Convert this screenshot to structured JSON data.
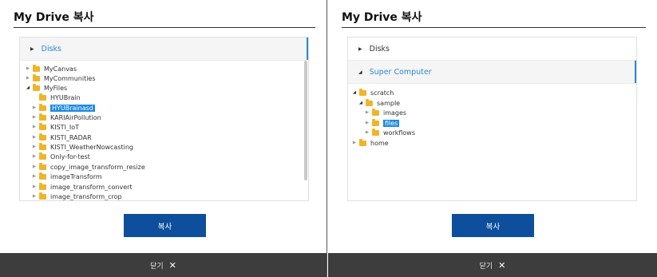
{
  "left": {
    "title": "My Drive 복사",
    "disks_label": "Disks",
    "items": [
      {
        "label": "MyCanvas"
      },
      {
        "label": "MyCommunities"
      },
      {
        "label": "MyFiles"
      },
      {
        "label": "HYUBrain"
      },
      {
        "label": "HYUBrainasd"
      },
      {
        "label": "KARIAirPollution"
      },
      {
        "label": "KISTI_IoT"
      },
      {
        "label": "KISTI_RADAR"
      },
      {
        "label": "KISTI_WeatherNowcasting"
      },
      {
        "label": "Only-for-test"
      },
      {
        "label": "copy_image_transform_resize"
      },
      {
        "label": "imageTransform"
      },
      {
        "label": "image_transform_convert"
      },
      {
        "label": "image_transform_crop"
      }
    ],
    "copy_label": "복사",
    "close_label": "닫기"
  },
  "right": {
    "title": "My Drive 복사",
    "disks_label": "Disks",
    "super_label": "Super Computer",
    "items": [
      {
        "label": "scratch"
      },
      {
        "label": "sample"
      },
      {
        "label": "images"
      },
      {
        "label": "files"
      },
      {
        "label": "workflows"
      },
      {
        "label": "home"
      }
    ],
    "copy_label": "복사",
    "close_label": "닫기"
  },
  "colors": {
    "accent": "#2a8ad6",
    "button": "#0d4f9c",
    "selection": "#1f8ae0",
    "footer": "#3d3d3d",
    "folder": "#f0b429"
  }
}
